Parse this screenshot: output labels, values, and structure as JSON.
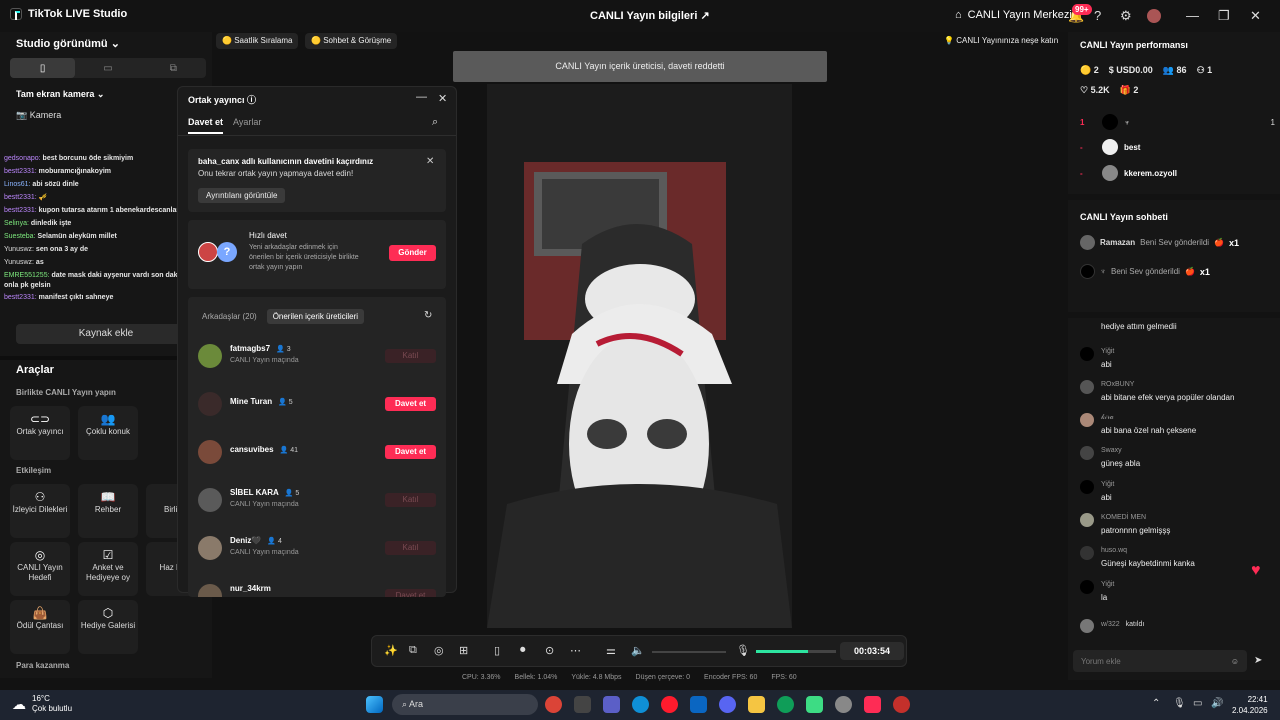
{
  "window": {
    "app_title": "TikTok LIVE Studio",
    "center_title": "CANLI Yayın bilgileri",
    "live_center": "CANLI Yayın Merkezi",
    "notif_badge": "99+"
  },
  "left": {
    "studio_view": "Studio görünümü",
    "fullscreen_camera": "Tam ekran kamera",
    "camera": "Kamera",
    "chat": [
      {
        "user": "gedsonapo:",
        "text": "best borcunu öde sikmiyim"
      },
      {
        "user": "bestt2331:",
        "text": "moburamcığınakoyim"
      },
      {
        "user": "Linos61:",
        "text": "abi sözü dinle"
      },
      {
        "user": "bestt2331:",
        "text": "🎺"
      },
      {
        "user": "bestt2331:",
        "text": "kupon tutarsa atarım 1 abenekardescanlar"
      },
      {
        "user": "Selinya:",
        "text": "dinledik işte"
      },
      {
        "user": "Suesteba:",
        "text": "Selamün aleyküm millet"
      },
      {
        "user": "Yunuswz:",
        "text": "sen ona 3 ay de"
      },
      {
        "user": "Yunuswz:",
        "text": "as"
      },
      {
        "user": "EMRE551255:",
        "text": "date mask daki ayşenur vardı son dakika giden onla pk gelsin"
      },
      {
        "user": "bestt2331:",
        "text": "manifest çıktı sahneye"
      }
    ],
    "add_source": "Kaynak ekle",
    "tools_title": "Araçlar",
    "together_live": "Birlikte CANLI Yayın yapın",
    "co_host": "Ortak yayıncı",
    "multi_guest": "Çoklu konuk",
    "interaction": "Etkileşim",
    "viewer_requests": "İzleyici Dilekleri",
    "guide": "Rehber",
    "together_cut": "Birlikte",
    "live_goal": "CANLI Yayın Hedefi",
    "poll": "Anket ve Hediyeye oy",
    "ready_cut": "Haz Kutu",
    "reward_bag": "Ödül Çantası",
    "gift_gallery": "Hediye Galerisi",
    "earn_money": "Para kazanma"
  },
  "top_pills": {
    "hourly_rank": "Saatlik Sıralama",
    "chat_meet": "Sohbet & Görüşme",
    "fun": "CANLI Yayınınıza neşe katın"
  },
  "toast": "CANLI Yayın içerik üreticisi, daveti reddetti",
  "modal": {
    "title": "Ortak yayıncı",
    "tab_invite": "Davet et",
    "tab_settings": "Ayarlar",
    "missed_title": "baha_canx adlı kullanıcının davetini kaçırdınız",
    "missed_text": "Onu tekrar ortak yayın yapmaya davet edin!",
    "details": "Ayrıntılanı görüntüle",
    "quick_title": "Hızlı davet",
    "quick_text": "Yeni arkadaşlar edinmek için önerilen bir içerik üreticisiyle birlikte ortak yayın yapın",
    "send": "Gönder",
    "friends_tab": "Arkadaşlar (20)",
    "suggested_tab": "Önerilen içerik üreticileri",
    "rows": [
      {
        "name": "fatmagbs7",
        "count": "3",
        "sub": "CANLI Yayın maçında",
        "btn": "Katıl",
        "state": "off",
        "color": "#6b8a3a"
      },
      {
        "name": "Mine Turan",
        "count": "5",
        "sub": "",
        "btn": "Davet et",
        "state": "on",
        "color": "#3a2a2a"
      },
      {
        "name": "cansuvibes",
        "count": "41",
        "sub": "",
        "btn": "Davet et",
        "state": "on",
        "color": "#7a4a3a"
      },
      {
        "name": "SİBEL KARA",
        "count": "5",
        "sub": "CANLI Yayın maçında",
        "btn": "Katıl",
        "state": "off",
        "color": "#5a5a5a"
      },
      {
        "name": "Deniz🖤",
        "count": "4",
        "sub": "CANLI Yayın maçında",
        "btn": "Katıl",
        "state": "off",
        "color": "#8a7a6a"
      },
      {
        "name": "nur_34krm",
        "count": "",
        "sub": "",
        "btn": "Davet et",
        "state": "off",
        "color": "#6a5a4a"
      }
    ]
  },
  "bottom": {
    "timer": "00:03:54",
    "cpu": "CPU: 3.36%",
    "memory": "Bellek: 1.04%",
    "upload": "Yükle: 4.8 Mbps",
    "dropped": "Düşen çerçeve: 0",
    "encoder_fps": "Encoder FPS: 60",
    "fps": "FPS: 60",
    "volume_level": 0.0,
    "mic_level": 0.65
  },
  "right": {
    "perf_title": "CANLI Yayın performansı",
    "coins": "2",
    "usd": "USD0.00",
    "viewers": "86",
    "follows": "1",
    "likes": "5.2K",
    "gifts": "2",
    "ranking": [
      {
        "n": "1",
        "name": "♆",
        "score": "1",
        "color": "#111"
      },
      {
        "n": "-",
        "name": "best",
        "score": "",
        "color": "#eee"
      },
      {
        "n": "-",
        "name": "kkerem.ozyoll",
        "score": "",
        "color": "#888"
      }
    ],
    "chat_title": "CANLI Yayın sohbeti",
    "gift_msgs": [
      {
        "user": "Ramazan",
        "text": "Beni Sev gönderildi",
        "x": "x1"
      },
      {
        "user": "♆",
        "text": "Beni Sev gönderildi",
        "x": "x1"
      }
    ],
    "messages": [
      {
        "user": "",
        "text": "hediye attım gelmedii"
      },
      {
        "user": "Yiğit",
        "text": "abi"
      },
      {
        "user": "ROxBUNY",
        "text": "abi bitane efek verya popüler olandan"
      },
      {
        "user": "𝓀𝒾𝓇𝒶",
        "text": "abi bana özel nah çeksene"
      },
      {
        "user": "Swaxy",
        "text": "güneş abla"
      },
      {
        "user": "Yiğit",
        "text": "abi"
      },
      {
        "user": "KOMEDİ MEN",
        "text": "patronnnn gelmişşş"
      },
      {
        "user": "huso.wq",
        "text": "Güneşi kaybetdinmi kanka"
      },
      {
        "user": "Yiğit",
        "text": "la"
      },
      {
        "user": "w/322",
        "text": "katıldı"
      }
    ],
    "comment_placeholder": "Yorum ekle"
  },
  "taskbar": {
    "temp": "16°C",
    "weather": "Çok bulutlu",
    "search": "Ara",
    "time": "22:41",
    "date": "2.04.2026"
  }
}
